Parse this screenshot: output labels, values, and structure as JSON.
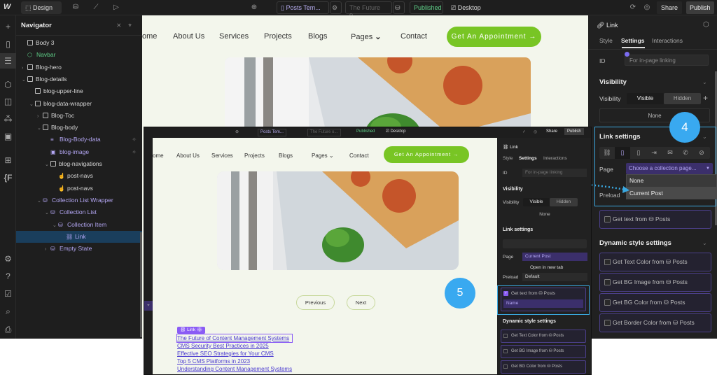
{
  "topbar": {
    "logo": "W",
    "mode": "Design",
    "page": "Posts Tem...",
    "item": "The Future o...",
    "status": "Published",
    "breakpoint": "Desktop",
    "share": "Share",
    "publish": "Publish"
  },
  "navigator": {
    "title": "Navigator",
    "items": [
      {
        "label": "Body 3",
        "depth": 0,
        "caret": "",
        "icon": "box"
      },
      {
        "label": "Navbar",
        "depth": 0,
        "caret": "",
        "icon": "component",
        "style": "green"
      },
      {
        "label": "Blog-hero",
        "depth": 0,
        "caret": "›",
        "icon": "box"
      },
      {
        "label": "Blog-details",
        "depth": 0,
        "caret": "⌄",
        "icon": "box"
      },
      {
        "label": "blog-upper-line",
        "depth": 1,
        "caret": "",
        "icon": "box"
      },
      {
        "label": "blog-data-wrapper",
        "depth": 1,
        "caret": "⌄",
        "icon": "box"
      },
      {
        "label": "Blog-Toc",
        "depth": 2,
        "caret": "›",
        "icon": "box"
      },
      {
        "label": "Blog-body",
        "depth": 2,
        "caret": "⌄",
        "icon": "box"
      },
      {
        "label": "Blog-Body-data",
        "depth": 3,
        "caret": "",
        "icon": "richtext",
        "style": "purple",
        "pin": true
      },
      {
        "label": "blog-image",
        "depth": 3,
        "caret": "",
        "icon": "image",
        "style": "purple",
        "pin": true
      },
      {
        "label": "blog-navigations",
        "depth": 3,
        "caret": "⌄",
        "icon": "box"
      },
      {
        "label": "post-navs",
        "depth": 4,
        "caret": "",
        "icon": "pointer"
      },
      {
        "label": "post-navs",
        "depth": 4,
        "caret": "",
        "icon": "pointer"
      },
      {
        "label": "Collection List Wrapper",
        "depth": 2,
        "caret": "⌄",
        "icon": "db",
        "style": "purple"
      },
      {
        "label": "Collection List",
        "depth": 3,
        "caret": "⌄",
        "icon": "db",
        "style": "purple"
      },
      {
        "label": "Collection Item",
        "depth": 4,
        "caret": "⌄",
        "icon": "db",
        "style": "purple"
      },
      {
        "label": "Link",
        "depth": 5,
        "caret": "",
        "icon": "link",
        "style": "purple",
        "selected": true
      },
      {
        "label": "Empty State",
        "depth": 3,
        "caret": "›",
        "icon": "db",
        "style": "purple"
      }
    ]
  },
  "site": {
    "menu": [
      "ome",
      "About Us",
      "Services",
      "Projects",
      "Blogs",
      "Pages",
      "Contact"
    ],
    "cta": "Get An Appointment →",
    "prev": "Previous",
    "next": "Next",
    "link_badge": "Link",
    "links": [
      "The Future of Content Management Systems",
      "CMS Security Best Practices in 2025",
      "Effective SEO Strategies for Your CMS",
      "Top 5 CMS Platforms in 2023",
      "Understanding Content Management Systems"
    ]
  },
  "panel": {
    "element": "Link",
    "tabs": [
      "Style",
      "Settings",
      "Interactions"
    ],
    "id_label": "ID",
    "id_placeholder": "For in-page linking",
    "visibility_title": "Visibility",
    "visibility_label": "Visibility",
    "visible": "Visible",
    "hidden": "Hidden",
    "none": "None",
    "link_settings": "Link settings",
    "page_label": "Page",
    "page_value": "Choose a collection page...",
    "page_value_2": "Current Post",
    "dropdown_options": [
      "None",
      "Current Post"
    ],
    "open_new_tab": "Open in new tab",
    "preload_label": "Preload",
    "preload_value": "Default",
    "get_text": "Get text from",
    "posts": "Posts",
    "name_field": "Name",
    "dynamic_title": "Dynamic style settings",
    "dynamic_items": [
      "Get Text Color from",
      "Get BG Image from",
      "Get BG Color from",
      "Get Border Color from"
    ]
  },
  "annotations": {
    "step4": "4",
    "step5": "5"
  },
  "colors": {
    "accent": "#78c524",
    "badge": "#39a9f0",
    "cms": "#b4a7f4",
    "highlight": "#3aa8e0"
  }
}
